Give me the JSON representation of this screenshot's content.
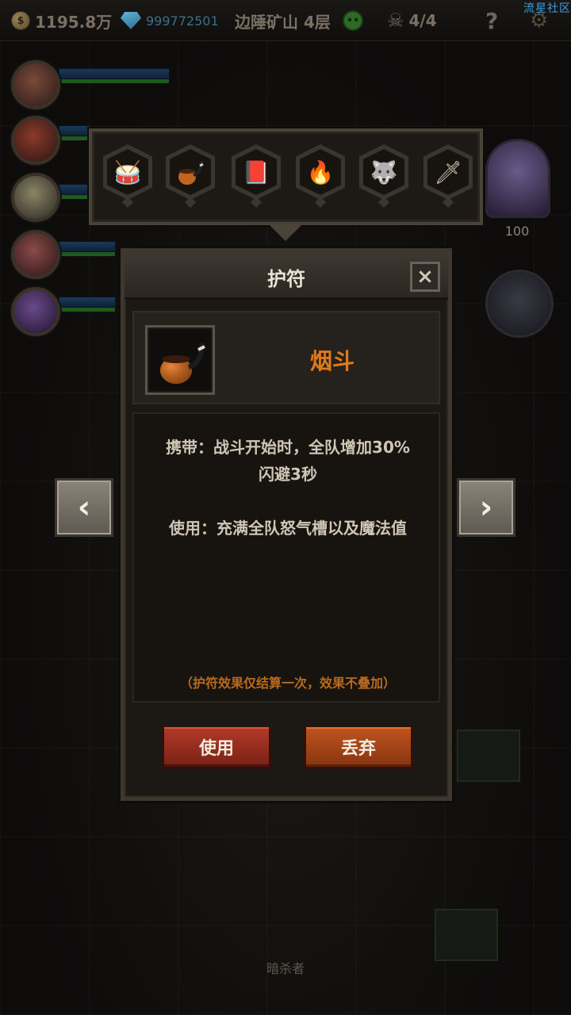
{
  "topbar": {
    "gold": "1195.8万",
    "gems": "999772501",
    "location": "边陲矿山 4层",
    "kills": "4/4",
    "help": "?",
    "watermark": "流星社区"
  },
  "icons": {
    "coin": "$",
    "gem": "diamond-gem",
    "face": "green-face",
    "skull": "☠",
    "gear": "⚙"
  },
  "charms": [
    {
      "name": "drum",
      "glyph": "🥁"
    },
    {
      "name": "pipe",
      "glyph": ""
    },
    {
      "name": "book",
      "glyph": "📕"
    },
    {
      "name": "fire-orb",
      "glyph": "🔥"
    },
    {
      "name": "wolf-head",
      "glyph": "🐺"
    },
    {
      "name": "spear",
      "glyph": "🗡"
    }
  ],
  "side": {
    "angel_count": "100"
  },
  "dialog": {
    "title": "护符",
    "close": "×",
    "item_name": "烟斗",
    "desc_line1": "携带：战斗开始时，全队增加30%",
    "desc_line2": "闪避3秒",
    "desc_line3": "使用：充满全队怒气槽以及魔法值",
    "note": "（护符效果仅结算一次，效果不叠加）",
    "use_label": "使用",
    "discard_label": "丢弃"
  },
  "nav": {
    "prev": "‹",
    "next": "›"
  },
  "bottom": {
    "label": "暗杀者"
  },
  "colors": {
    "item_name": "#e07a1a",
    "note": "#b86a1e",
    "use_button": "#b23a28",
    "discard_button": "#c0541e"
  }
}
